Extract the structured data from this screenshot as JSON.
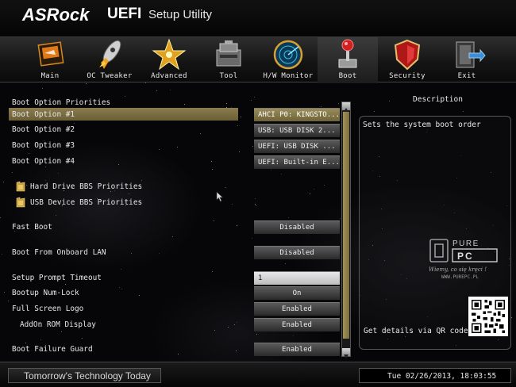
{
  "header": {
    "brand": "ASRock",
    "uefi": "UEFI",
    "subtitle": "Setup Utility"
  },
  "tabs": [
    {
      "label": "Main",
      "icon": "main-icon"
    },
    {
      "label": "OC Tweaker",
      "icon": "rocket-icon"
    },
    {
      "label": "Advanced",
      "icon": "star-icon"
    },
    {
      "label": "Tool",
      "icon": "toolbox-icon"
    },
    {
      "label": "H/W Monitor",
      "icon": "radar-icon"
    },
    {
      "label": "Boot",
      "icon": "joystick-icon"
    },
    {
      "label": "Security",
      "icon": "shield-icon"
    },
    {
      "label": "Exit",
      "icon": "exit-door-icon"
    }
  ],
  "active_tab": "Boot",
  "boot": {
    "section_title": "Boot Option Priorities",
    "options": [
      {
        "label": "Boot Option #1",
        "value": "AHCI P0: KINGSTO..."
      },
      {
        "label": "Boot Option #2",
        "value": "USB:  USB DISK 2..."
      },
      {
        "label": "Boot Option #3",
        "value": "UEFI:  USB DISK ..."
      },
      {
        "label": "Boot Option #4",
        "value": "UEFI: Built-in E..."
      }
    ],
    "submenus": [
      {
        "label": "Hard Drive BBS Priorities",
        "icon": "folder-icon"
      },
      {
        "label": "USB Device BBS Priorities",
        "icon": "folder-icon"
      }
    ],
    "settings": {
      "fast_boot": {
        "label": "Fast Boot",
        "value": "Disabled"
      },
      "boot_from_lan": {
        "label": "Boot From Onboard LAN",
        "value": "Disabled"
      },
      "setup_prompt_timeout": {
        "label": "Setup Prompt Timeout",
        "value": "1"
      },
      "numlock": {
        "label": "Bootup Num-Lock",
        "value": "On"
      },
      "full_screen_logo": {
        "label": "Full Screen Logo",
        "value": "Enabled"
      },
      "addon_rom": {
        "label": "AddOn ROM Display",
        "value": "Enabled"
      },
      "boot_failure_guard": {
        "label": "Boot Failure Guard",
        "value": "Enabled"
      }
    }
  },
  "description": {
    "title": "Description",
    "text": "Sets the system boot order",
    "qr_hint": "Get details via QR code"
  },
  "watermark": {
    "logo_text": "PURE PC",
    "tagline": "Wiemy, co się kręci !",
    "url": "WWW.PUREPC.PL"
  },
  "footer": {
    "slogan": "Tomorrow's Technology Today",
    "datetime": "Tue 02/26/2013, 18:03:55"
  },
  "colors": {
    "selection": "#8a7c4e",
    "scroll_thumb": "#a39358"
  }
}
